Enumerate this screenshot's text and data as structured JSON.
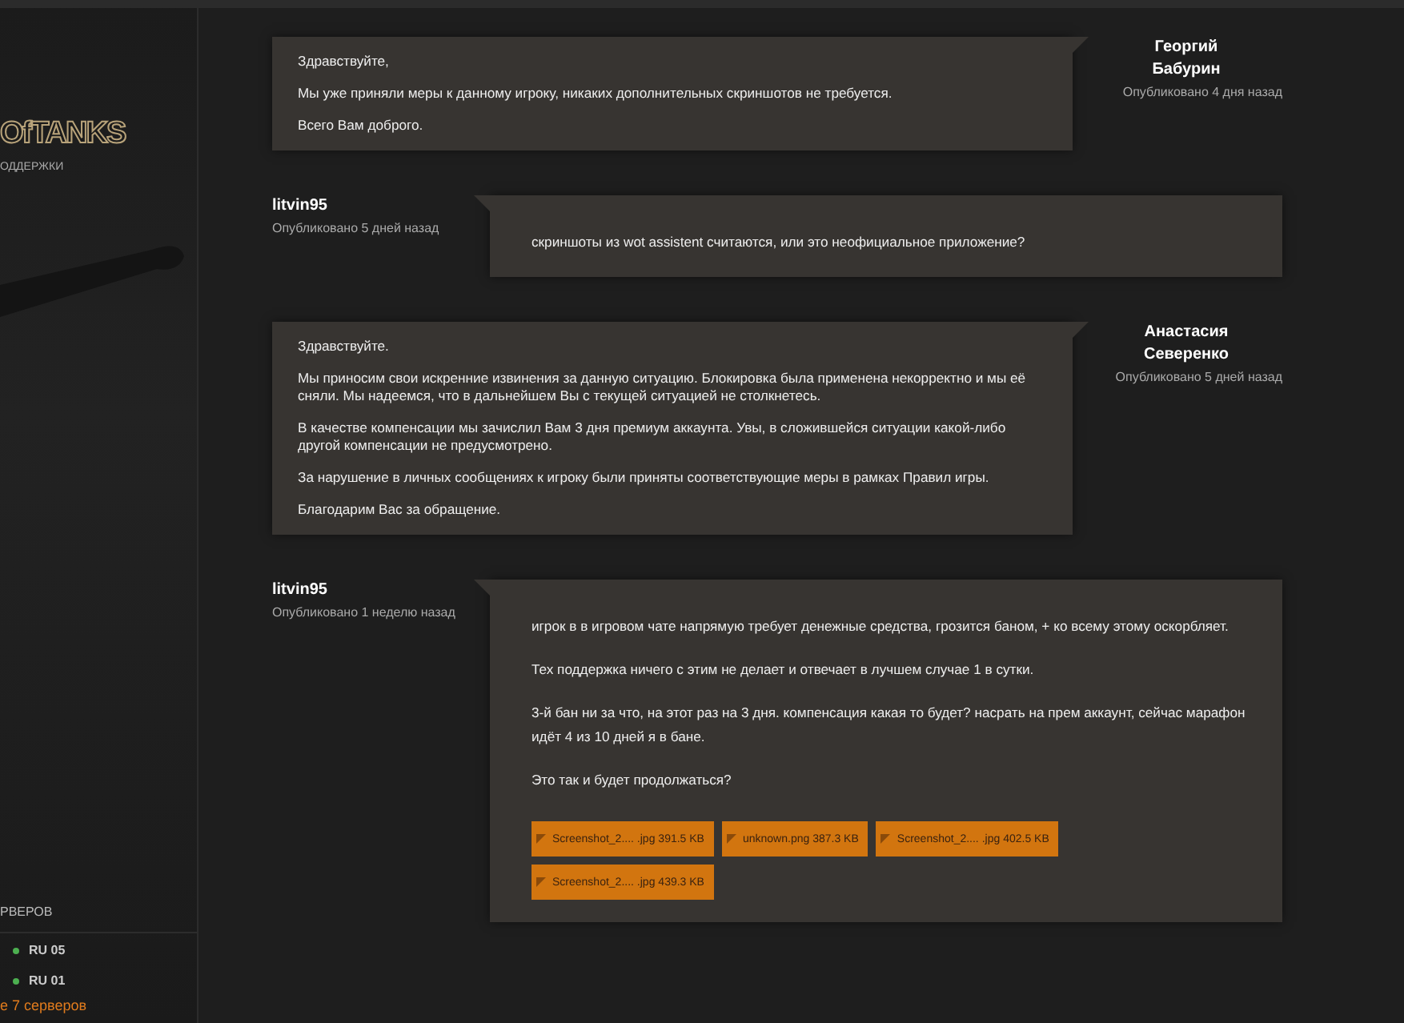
{
  "sidebar": {
    "logo": "OfTANKS",
    "subtitle": "ОДДЕРЖКИ",
    "servers_heading": "РВЕРОВ",
    "servers": [
      {
        "name": "RU 05",
        "online": true
      },
      {
        "name": "RU 01",
        "online": true
      }
    ],
    "all_servers_link": "е 7 серверов"
  },
  "posts": [
    {
      "kind": "support",
      "author": "Георгий Бабурин",
      "date": "Опубликовано 4 дня назад",
      "paragraphs": [
        "Здравствуйте,",
        "Мы уже приняли меры к данному игроку, никаких дополнительных скриншотов не требуется.",
        "Всего Вам доброго."
      ]
    },
    {
      "kind": "user",
      "author": "litvin95",
      "date": "Опубликовано 5 дней назад",
      "paragraphs": [
        "скриншоты из wot assistent считаются, или это неофициальное приложение?"
      ]
    },
    {
      "kind": "support",
      "author": "Анастасия Северенко",
      "date": "Опубликовано 5 дней назад",
      "paragraphs": [
        "Здравствуйте.",
        "Мы приносим свои искренние извинения за данную ситуацию. Блокировка была применена некорректно и мы её сняли. Мы надеемся, что в дальнейшем Вы с текущей ситуацией не столкнетесь.",
        "В качестве компенсации мы зачислил Вам 3 дня премиум аккаунта. Увы, в сложившейся ситуации какой-либо другой компенсации не предусмотрено.",
        "За нарушение в личных сообщениях к игроку были приняты соответствующие меры в рамках Правил игры.",
        "Благодарим Вас за обращение."
      ]
    },
    {
      "kind": "user",
      "author": "litvin95",
      "date": "Опубликовано 1 неделю назад",
      "paragraphs": [
        "игрок в в игровом чате напрямую требует денежные средства, грозится баном, + ко всему этому оскорбляет.",
        "Тех поддержка ничего с этим не делает и отвечает в лучшем случае 1 в сутки.",
        "3-й бан ни за что, на этот раз на 3 дня. компенсация какая то будет? насрать на прем аккаунт, сейчас марафон идёт 4 из 10 дней я в бане.",
        "Это так и будет продолжаться?"
      ],
      "attachments": [
        {
          "name": "Screenshot_2.... .jpg",
          "size": "391.5 KB"
        },
        {
          "name": "unknown.png",
          "size": "387.3 KB"
        },
        {
          "name": "Screenshot_2.... .jpg",
          "size": "402.5 KB"
        },
        {
          "name": "Screenshot_2.... .jpg",
          "size": "439.3 KB"
        }
      ]
    }
  ]
}
